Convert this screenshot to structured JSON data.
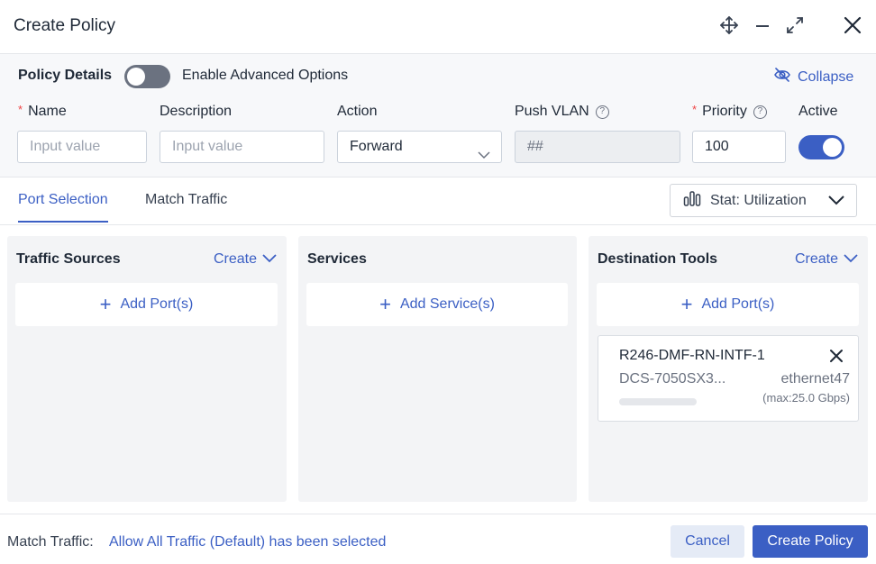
{
  "window": {
    "title": "Create Policy",
    "icons": [
      "move-icon",
      "minimize-icon",
      "expand-icon",
      "close-icon"
    ]
  },
  "policy_details": {
    "label": "Policy Details",
    "advanced_toggle": {
      "label": "Enable Advanced Options",
      "on": false
    },
    "collapse_label": "Collapse",
    "fields": {
      "name": {
        "label": "Name",
        "required": "*",
        "placeholder": "Input value",
        "value": ""
      },
      "description": {
        "label": "Description",
        "placeholder": "Input value",
        "value": ""
      },
      "action": {
        "label": "Action",
        "value": "Forward"
      },
      "push_vlan": {
        "label": "Push VLAN",
        "placeholder": "##",
        "help": "?"
      },
      "priority": {
        "label": "Priority",
        "required": "*",
        "value": "100",
        "help": "?"
      },
      "active": {
        "label": "Active",
        "on": true
      }
    }
  },
  "tabs": [
    {
      "label": "Port Selection",
      "active": true
    },
    {
      "label": "Match Traffic",
      "active": false
    }
  ],
  "stat_selector": {
    "label": "Stat: Utilization"
  },
  "panels": {
    "traffic_sources": {
      "title": "Traffic Sources",
      "create_label": "Create",
      "add_label": "Add Port(s)"
    },
    "services": {
      "title": "Services",
      "add_label": "Add Service(s)"
    },
    "destination_tools": {
      "title": "Destination Tools",
      "create_label": "Create",
      "add_label": "Add Port(s)",
      "ports": [
        {
          "name": "R246-DMF-RN-INTF-1",
          "model": "DCS-7050SX3...",
          "interface": "ethernet47",
          "max": "(max:25.0 Gbps)",
          "utilization": 0
        }
      ]
    }
  },
  "footer": {
    "match_label": "Match Traffic:",
    "match_value": "Allow All Traffic (Default) has been selected",
    "cancel_label": "Cancel",
    "create_label": "Create Policy"
  },
  "colors": {
    "accent": "#3b5fc4",
    "required": "#ef4444",
    "panel_bg": "#f3f4f6"
  }
}
